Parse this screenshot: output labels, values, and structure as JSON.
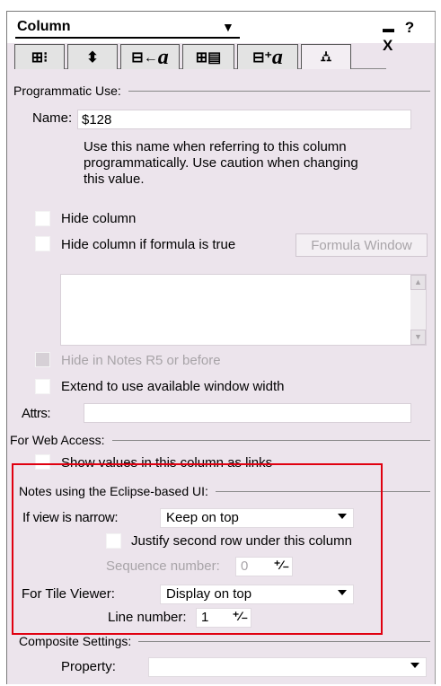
{
  "titlebar": {
    "title": "Column",
    "dropdown_arrow": "▼",
    "menu_glyph": "▬",
    "help_glyph": "?",
    "close_glyph": "X"
  },
  "tabs": [
    {
      "glyph": "⊞⁝",
      "icon": "column-info-icon"
    },
    {
      "glyph": "⬍",
      "icon": "sorting-icon"
    },
    {
      "glyph": "⊟←",
      "icon": "column-font-icon",
      "italic": "a"
    },
    {
      "glyph": "⊞▤",
      "icon": "numbers-format-icon"
    },
    {
      "glyph": "⊟⁺",
      "icon": "title-font-icon",
      "italic": "a"
    },
    {
      "glyph": "⛼",
      "icon": "advanced-hat-icon"
    }
  ],
  "programmatic": {
    "heading": "Programmatic Use:",
    "name_label": "Name:",
    "name_value": "$128",
    "help_line1": "Use this name when referring to this column",
    "help_line2": "programmatically.  Use caution when changing",
    "help_line3": "this value.",
    "hide_column": "Hide column",
    "hide_if_formula": "Hide column if formula is true",
    "formula_window": "Formula Window",
    "hide_notes_r5": "Hide in Notes R5 or before",
    "extend_width": "Extend to use available window width",
    "attrs_label": "Attrs:",
    "attrs_value": ""
  },
  "web": {
    "heading": "For Web Access:",
    "show_links": "Show values in this column as links"
  },
  "eclipse": {
    "heading": "Notes using the  Eclipse-based UI:",
    "narrow_label": "If view is narrow:",
    "narrow_value": "Keep on top",
    "justify": "Justify second row under this column",
    "seq_label": "Sequence number:",
    "seq_value": "0",
    "tile_label": "For Tile Viewer:",
    "tile_value": "Display on top",
    "line_label": "Line number:",
    "line_value": "1",
    "spin_glyph": "⁺⁄₋"
  },
  "composite": {
    "heading": "Composite Settings:",
    "property_label": "Property:",
    "property_value": ""
  },
  "colors": {
    "panel_bg": "#ece4ec",
    "highlight": "#e00010"
  }
}
